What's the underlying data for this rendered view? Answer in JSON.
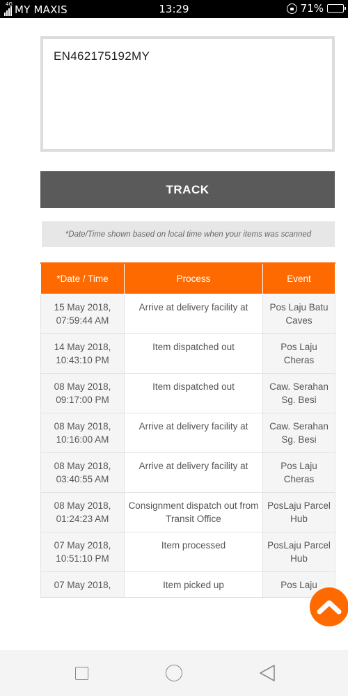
{
  "status_bar": {
    "network_type": "4G",
    "carrier": "MY MAXIS",
    "time": "13:29",
    "battery_percent": "71%",
    "battery_level": 0.71,
    "icons": [
      "signal-icon",
      "rotation-lock-icon",
      "battery-icon"
    ]
  },
  "tracking_input": {
    "value": "EN462175192MY"
  },
  "track_button": {
    "label": "TRACK"
  },
  "notice": {
    "text": "*Date/Time shown based on local time when your items was scanned"
  },
  "table": {
    "headers": [
      "*Date / Time",
      "Process",
      "Event"
    ],
    "rows": [
      {
        "date": "15 May 2018,",
        "time": "07:59:44 AM",
        "process": "Arrive at delivery facility at",
        "event": "Pos Laju Batu Caves"
      },
      {
        "date": "14 May 2018,",
        "time": "10:43:10 PM",
        "process": "Item dispatched out",
        "event": "Pos Laju Cheras"
      },
      {
        "date": "08 May 2018,",
        "time": "09:17:00 PM",
        "process": "Item dispatched out",
        "event": "Caw. Serahan Sg. Besi"
      },
      {
        "date": "08 May 2018,",
        "time": "10:16:00 AM",
        "process": "Arrive at delivery facility at",
        "event": "Caw. Serahan Sg. Besi"
      },
      {
        "date": "08 May 2018,",
        "time": "03:40:55 AM",
        "process": "Arrive at delivery facility at",
        "event": "Pos Laju Cheras"
      },
      {
        "date": "08 May 2018,",
        "time": "01:24:23 AM",
        "process": "Consignment dispatch out from Transit Office",
        "event": "PosLaju Parcel Hub"
      },
      {
        "date": "07 May 2018,",
        "time": "10:51:10 PM",
        "process": "Item processed",
        "event": "PosLaju Parcel Hub"
      },
      {
        "date": "07 May 2018,",
        "time": "",
        "process": "Item picked up",
        "event": "Pos Laju"
      }
    ]
  },
  "scroll_top_button": {
    "icon": "chevron-up-icon",
    "color": "#ff6a00"
  },
  "nav_bar": {
    "icons": [
      "recent-apps-icon",
      "home-icon",
      "back-icon"
    ]
  },
  "colors": {
    "accent": "#ff6a00",
    "button": "#5a5a5a",
    "notice_bg": "#e7e7e7"
  }
}
